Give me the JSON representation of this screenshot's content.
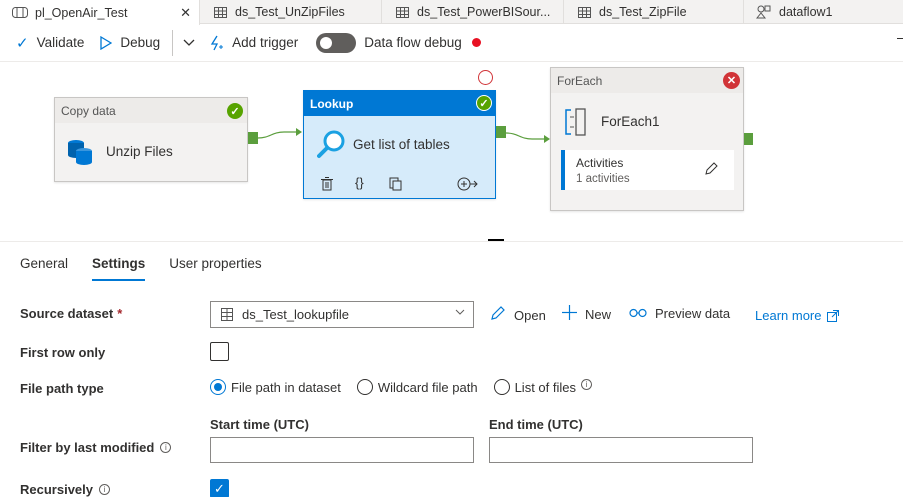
{
  "tabs": [
    {
      "label": "pl_OpenAir_Test",
      "icon": "pipeline-icon",
      "active": true,
      "close": "✕"
    },
    {
      "label": "ds_Test_UnZipFiles",
      "icon": "table-icon"
    },
    {
      "label": "ds_Test_PowerBISour...",
      "icon": "table-icon"
    },
    {
      "label": "ds_Test_ZipFile",
      "icon": "table-icon"
    },
    {
      "label": "dataflow1",
      "icon": "dataflow-icon"
    }
  ],
  "toolbar": {
    "validate": "Validate",
    "debug": "Debug",
    "add_trigger": "Add trigger",
    "data_flow_debug": "Data flow debug"
  },
  "canvas": {
    "copy_node": {
      "header": "Copy data",
      "title": "Unzip Files",
      "status": "success"
    },
    "lookup_node": {
      "header": "Lookup",
      "title": "Get list of tables",
      "status": "success"
    },
    "foreach_node": {
      "header": "ForEach",
      "title": "ForEach1",
      "activities_label": "Activities",
      "activities_count": "1 activities",
      "status": "error"
    }
  },
  "panel_tabs": [
    "General",
    "Settings",
    "User properties"
  ],
  "settings": {
    "source_dataset_label": "Source dataset",
    "source_dataset_required": "*",
    "source_dataset_value": "ds_Test_lookupfile",
    "open": "Open",
    "new": "New",
    "preview": "Preview data",
    "learn_more": "Learn more",
    "first_row_only_label": "First row only",
    "first_row_only_checked": false,
    "file_path_type_label": "File path type",
    "file_path_options": [
      "File path in dataset",
      "Wildcard file path",
      "List of files"
    ],
    "file_path_selected": "File path in dataset",
    "filter_label": "Filter by last modified",
    "start_time_label": "Start time (UTC)",
    "end_time_label": "End time (UTC)",
    "start_time_value": "",
    "end_time_value": "",
    "recursively_label": "Recursively",
    "recursively_checked": true
  },
  "colors": {
    "accent": "#0078d4",
    "success": "#57a300",
    "error": "#d13438"
  }
}
